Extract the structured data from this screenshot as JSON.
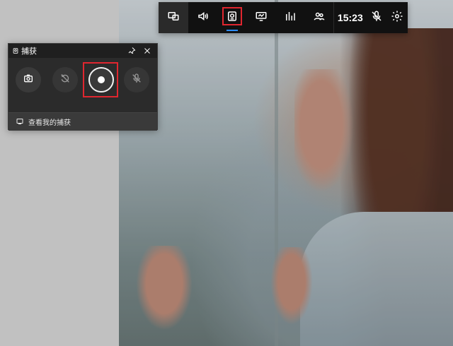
{
  "top_bar": {
    "time": "15:23",
    "icons": [
      "widget-menu-icon",
      "audio-icon",
      "capture-icon",
      "performance-icon",
      "resources-icon",
      "xbox-social-icon",
      "mic-off-icon",
      "settings-icon"
    ],
    "active_widget": "capture-icon",
    "colors": {
      "highlight_box": "#e0262f",
      "active_underline": "#2d8cff",
      "bar_bg": "#111111"
    }
  },
  "capture_panel": {
    "title": "捕获",
    "footer_link": "查看我的捕获",
    "icons": [
      "capture-panel-icon",
      "pin-icon",
      "close-icon",
      "screenshot-icon",
      "record-last-icon",
      "record-icon",
      "mic-off-icon",
      "gallery-icon"
    ],
    "colors": {
      "highlight_box": "#e0262f",
      "panel_bg": "#2b2b2b"
    }
  }
}
